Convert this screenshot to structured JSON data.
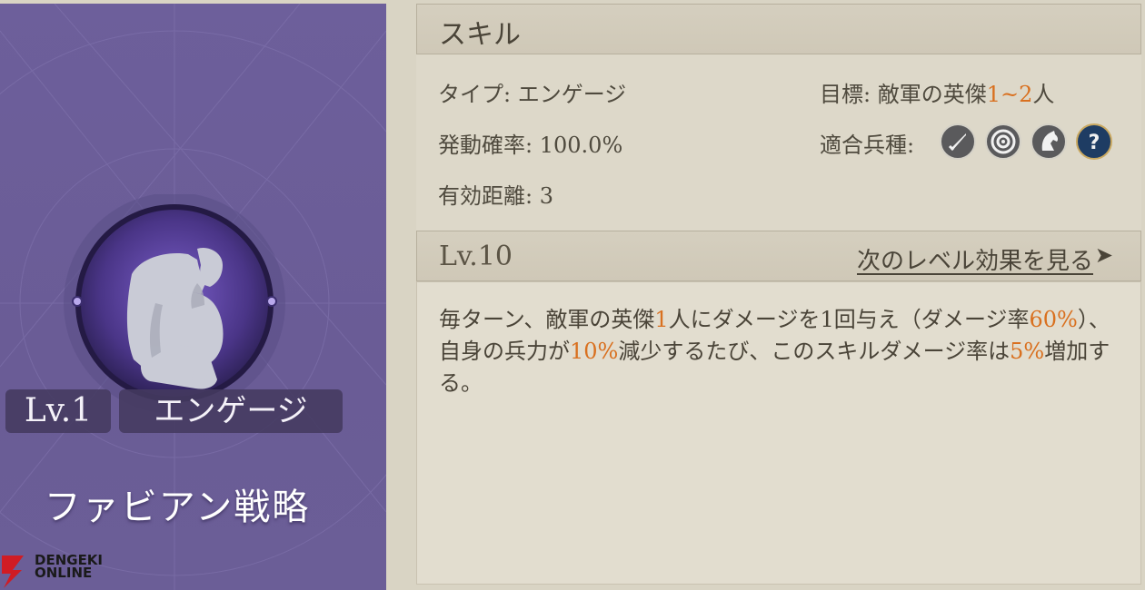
{
  "card": {
    "level": "Lv.1",
    "name": "エンゲージ",
    "title": "ファビアン戦略",
    "logo_line1": "DENGEKI",
    "logo_line2": "ONLINE",
    "emblem_icon": "thinker-statue-icon"
  },
  "skill": {
    "header": "スキル",
    "type_label": "タイプ:",
    "type_value": "エンゲージ",
    "rate_label": "発動確率:",
    "rate_value": "100.0%",
    "range_label": "有効距離:",
    "range_value": "3",
    "target_label": "目標:",
    "target_text": "敵軍の英傑",
    "target_count": "1~2",
    "target_unit": "人",
    "troop_label": "適合兵種:",
    "troop_icons": [
      "sword-icon",
      "target-icon",
      "horse-icon",
      "question-icon"
    ]
  },
  "level": {
    "label": "Lv.10",
    "next_link": "次のレベル効果を見る",
    "arrow": "➤"
  },
  "description": {
    "p1": "毎ターン、敵軍の英傑",
    "h1": "1",
    "p2": "人にダメージを1回与え（ダメージ率",
    "h2": "60%",
    "p3": "）、自身の兵力が",
    "h3": "10%",
    "p4": "減少するたび、このスキルダメージ率は",
    "h4": "5%",
    "p5": "増加する。"
  },
  "colors": {
    "card_bg": "#6d5f9b",
    "highlight": "#d9701f",
    "panel_bg": "#ddd8c9",
    "badge_bg": "#443a60"
  }
}
